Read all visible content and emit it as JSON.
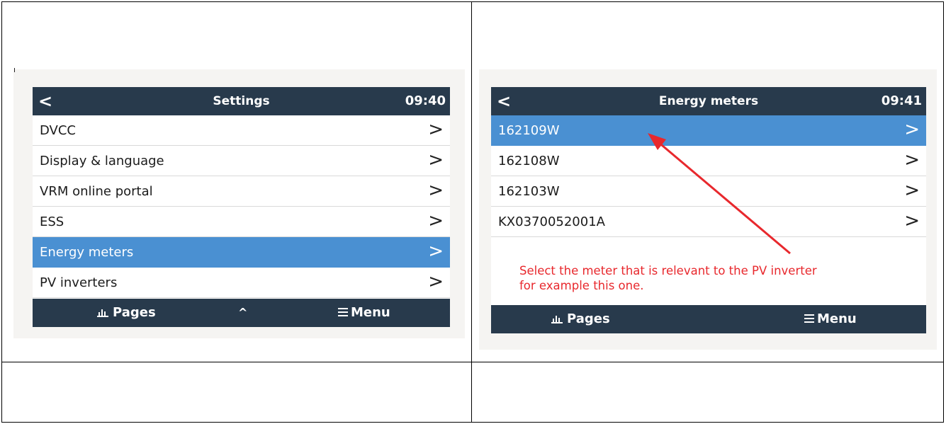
{
  "left_screen": {
    "header": {
      "back_glyph": "<",
      "title": "Settings",
      "time": "09:40"
    },
    "items": [
      {
        "label": "DVCC",
        "selected": false
      },
      {
        "label": "Display & language",
        "selected": false
      },
      {
        "label": "VRM online portal",
        "selected": false
      },
      {
        "label": "ESS",
        "selected": false
      },
      {
        "label": "Energy meters",
        "selected": true
      },
      {
        "label": "PV inverters",
        "selected": false
      }
    ],
    "footer": {
      "pages_label": "Pages",
      "up_glyph": "^",
      "menu_label": "Menu"
    }
  },
  "right_screen": {
    "header": {
      "back_glyph": "<",
      "title": "Energy meters",
      "time": "09:41"
    },
    "items": [
      {
        "label": "162109W",
        "selected": true
      },
      {
        "label": "162108W",
        "selected": false
      },
      {
        "label": "162103W",
        "selected": false
      },
      {
        "label": "KX0370052001A",
        "selected": false
      }
    ],
    "annotation": {
      "line1": "Select the meter that is relevant to the PV inverter",
      "line2": "for example this one."
    },
    "footer": {
      "pages_label": "Pages",
      "menu_label": "Menu"
    }
  },
  "icons": {
    "chevron": ">",
    "pages": "bar-chart-icon",
    "menu": "hamburger-menu-icon",
    "back": "chevron-left-icon",
    "up": "chevron-up-icon"
  },
  "colors": {
    "bar_bg": "#283a4c",
    "selected_row": "#4a90d2",
    "annotation_text": "#e8282d",
    "arrow": "#e8282d"
  }
}
